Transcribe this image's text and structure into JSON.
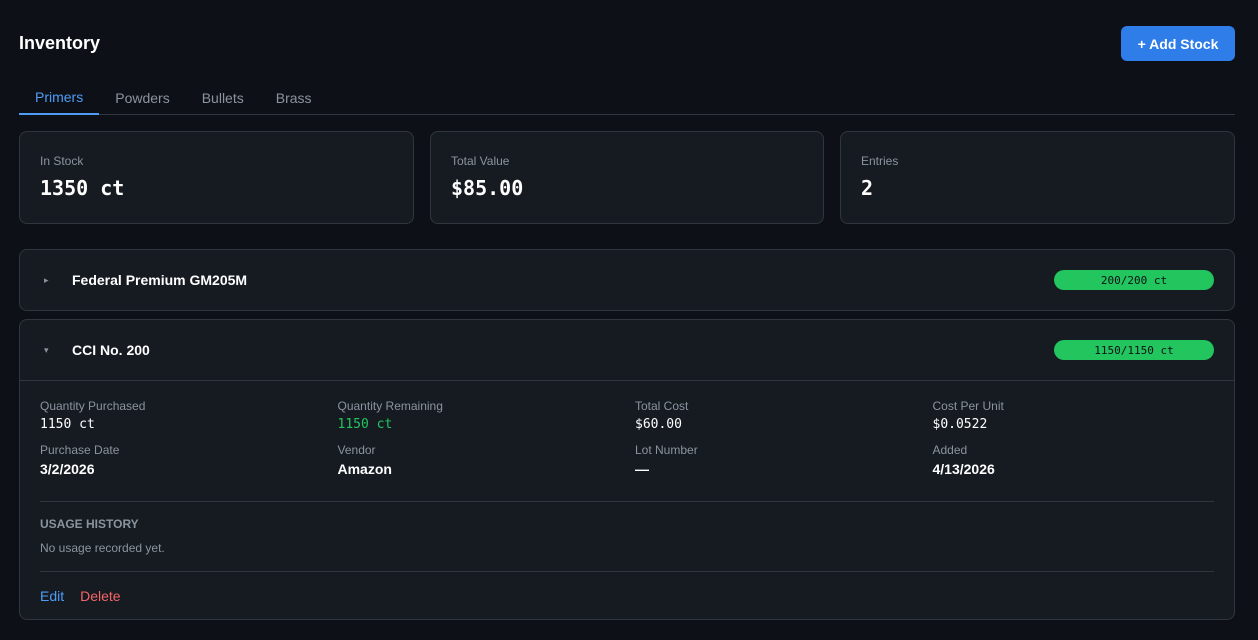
{
  "header": {
    "title": "Inventory",
    "add_button": "+ Add Stock"
  },
  "tabs": [
    {
      "label": "Primers",
      "active": true
    },
    {
      "label": "Powders",
      "active": false
    },
    {
      "label": "Bullets",
      "active": false
    },
    {
      "label": "Brass",
      "active": false
    }
  ],
  "stats": {
    "in_stock": {
      "label": "In Stock",
      "value": "1350 ct"
    },
    "total_value": {
      "label": "Total Value",
      "value": "$85.00"
    },
    "entries": {
      "label": "Entries",
      "value": "2"
    }
  },
  "entries": [
    {
      "name": "Federal Premium GM205M",
      "chevron": "▸",
      "expanded": false,
      "remaining_label": "200/200 ct",
      "remaining_fraction": 1.0
    },
    {
      "name": "CCI No. 200",
      "chevron": "▾",
      "expanded": true,
      "remaining_label": "1150/1150 ct",
      "remaining_fraction": 1.0,
      "details": {
        "quantity_purchased": {
          "label": "Quantity Purchased",
          "value": "1150 ct"
        },
        "quantity_remaining": {
          "label": "Quantity Remaining",
          "value": "1150 ct"
        },
        "total_cost": {
          "label": "Total Cost",
          "value": "$60.00"
        },
        "cost_per_unit": {
          "label": "Cost Per Unit",
          "value": "$0.0522"
        },
        "purchase_date": {
          "label": "Purchase Date",
          "value": "3/2/2026"
        },
        "vendor": {
          "label": "Vendor",
          "value": "Amazon"
        },
        "lot_number": {
          "label": "Lot Number",
          "value": "—"
        },
        "added": {
          "label": "Added",
          "value": "4/13/2026"
        }
      },
      "usage_history": {
        "heading": "USAGE HISTORY",
        "empty_text": "No usage recorded yet."
      },
      "actions": {
        "edit": "Edit",
        "delete": "Delete"
      }
    }
  ],
  "colors": {
    "background": "#0d1117",
    "card": "#161b22",
    "accent": "#2f7de9",
    "success": "#22c55e",
    "danger": "#f56565"
  }
}
